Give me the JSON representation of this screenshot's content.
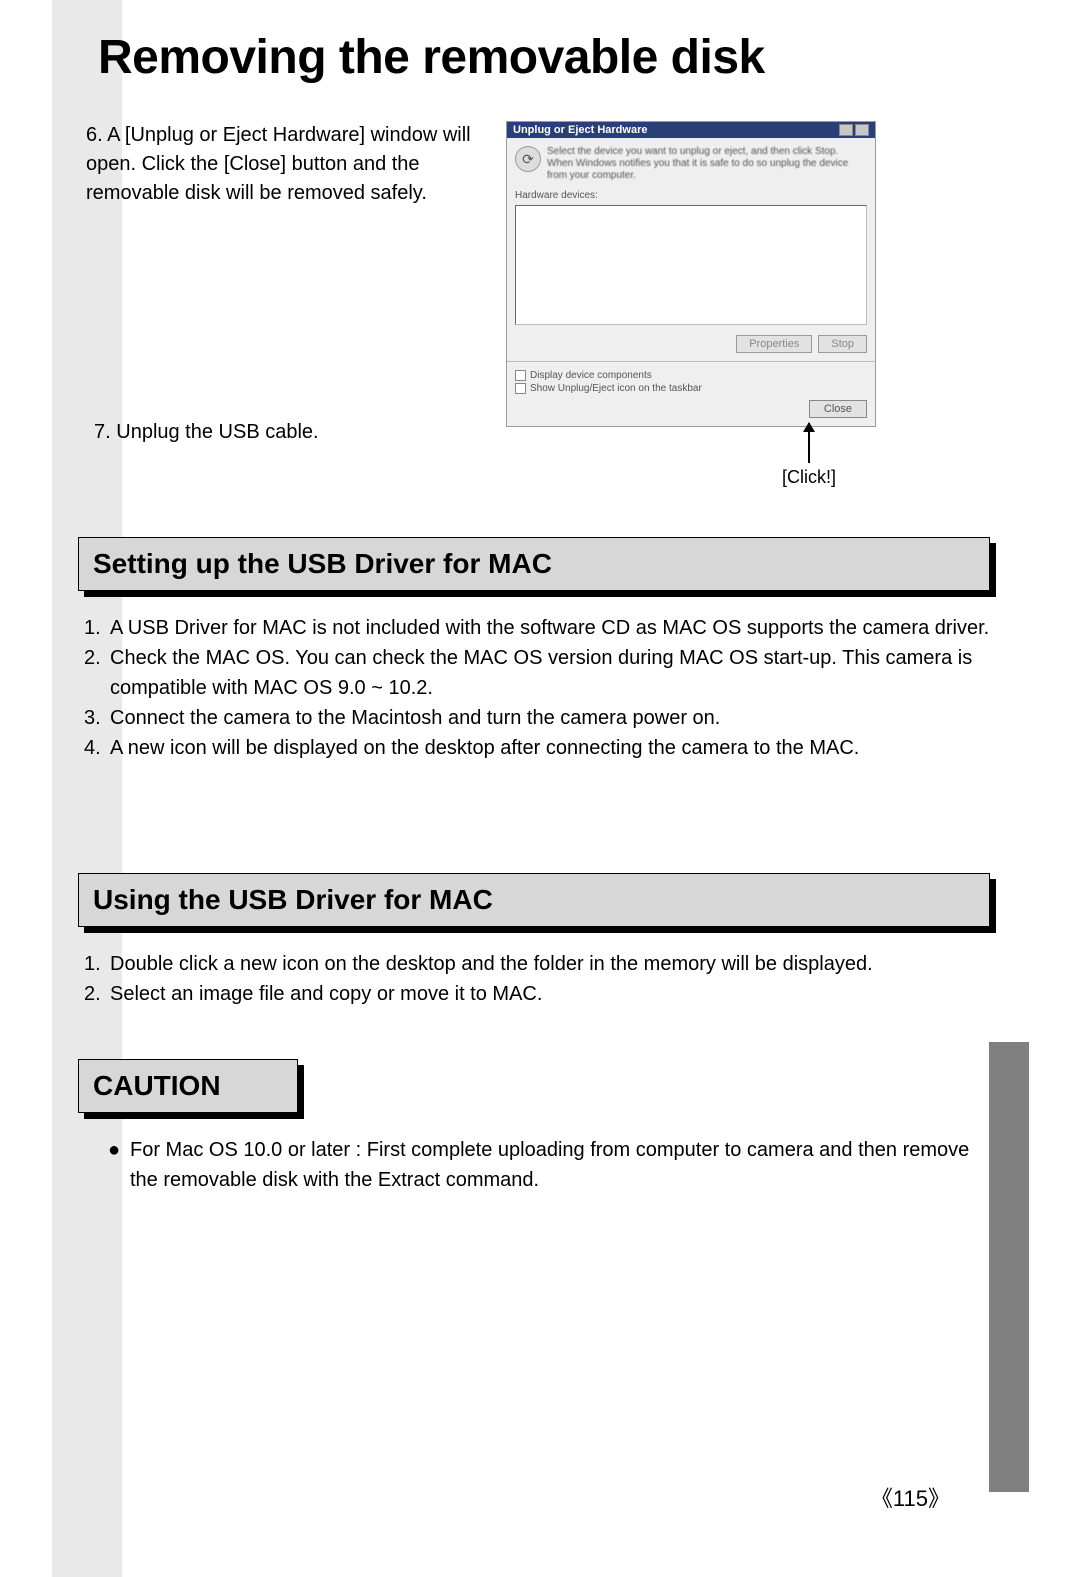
{
  "title": "Removing the removable disk",
  "step6": {
    "num": "6.",
    "text": "A [Unplug or Eject Hardware] window will open. Click the [Close] button and the removable disk will be removed safely."
  },
  "step7": {
    "num": "7.",
    "text": "Unplug the USB cable."
  },
  "dialog": {
    "title": "Unplug or Eject Hardware",
    "instr": "Select the device you want to unplug or eject, and then click Stop. When Windows notifies you that it is safe to do so unplug the device from your computer.",
    "sub": "Hardware devices:",
    "btn_props": "Properties",
    "btn_stop": "Stop",
    "chk1": "Display device components",
    "chk2": "Show Unplug/Eject icon on the taskbar",
    "close": "Close"
  },
  "click_label": "[Click!]",
  "setup": {
    "heading": "Setting up the USB Driver for MAC",
    "items": [
      "A USB Driver for MAC is not included with the software CD as MAC OS supports the camera driver.",
      "Check the MAC OS. You can check the MAC OS version during MAC OS start-up. This camera is compatible with MAC OS 9.0 ~ 10.2.",
      "Connect the camera to the Macintosh and turn the camera power on.",
      "A new icon will be displayed on the desktop after connecting the camera to the MAC."
    ]
  },
  "using": {
    "heading": "Using the USB Driver for MAC",
    "items": [
      "Double click a new icon on the desktop and the folder in the memory will be displayed.",
      "Select an image file and copy or move it to MAC."
    ]
  },
  "caution": {
    "heading": "CAUTION",
    "item": "For Mac OS 10.0 or later : First complete uploading from computer to camera and then remove the removable disk with the Extract command."
  },
  "page_number": "115"
}
